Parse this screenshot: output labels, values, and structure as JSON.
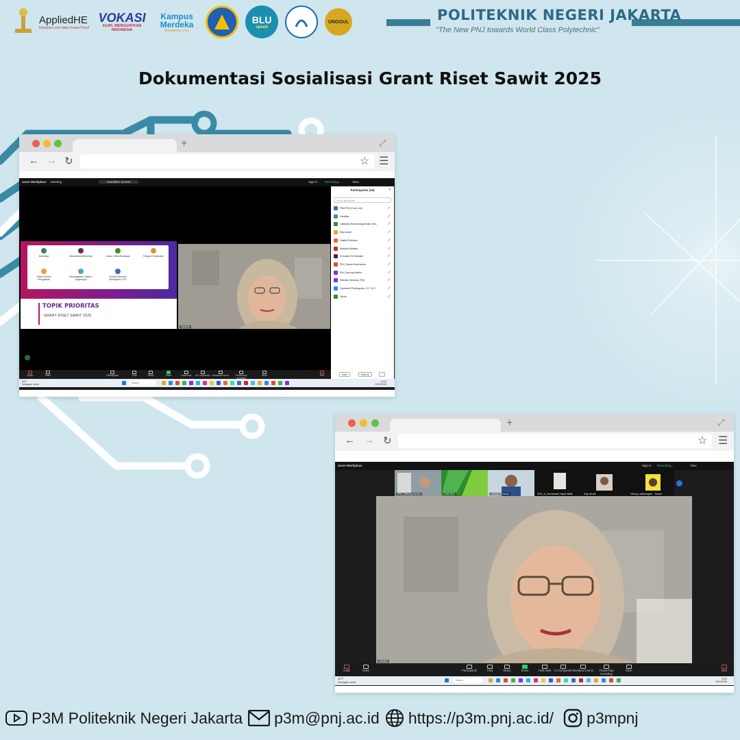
{
  "header": {
    "logos": [
      {
        "name": "appliedhe-logo",
        "text": "AppliedHE",
        "sub": "Entrance cost index Future Proof"
      },
      {
        "name": "vokasi-logo",
        "text": "VOKASI",
        "sub": "KUAT, MENGUATKAN INDONESIA"
      },
      {
        "name": "kampus-merdeka-logo",
        "text": "Kampus Merdeka",
        "sub": "INDONESIA JAYA"
      },
      {
        "name": "tut-wuri-logo",
        "text": ""
      },
      {
        "name": "blu-logo",
        "text": "BLU",
        "sub": "speed"
      },
      {
        "name": "pnj-logo",
        "text": ""
      },
      {
        "name": "unggul-logo",
        "text": "UNGGUL"
      }
    ],
    "institution": "POLITEKNIK NEGERI JAKARTA",
    "tagline": "\"The New PNJ towards World Class Polytechnic\""
  },
  "page_title": "Dokumentasi Sosialisasi Grant Riset Sawit 2025",
  "window1": {
    "zoom_brand": "zoom Workplace",
    "meeting_label": "Meeting",
    "speaker_label": "Handika's screen",
    "sign_in": "Sign in",
    "recording": "Recording...",
    "view": "View",
    "slide": {
      "items": [
        "Bioenergi",
        "Biomaterial (Biokimia)",
        "Lahan / Mitra Budidaya",
        "Pangan/ Kesehatan",
        "Pasca Panen/ Pengolahan",
        "Pemanganan Limbah / Lingkungan",
        "Sosial/ Ekonomi/ Manajemen KTP"
      ],
      "title": "TOPIK PRIORITAS",
      "subtitle": "GRANT RISET SAWIT 2025"
    },
    "camera_name": "Handika",
    "participants": {
      "title": "Participants (10)",
      "search": "Find a participant",
      "list": [
        "P3M PNJ (Host, me)",
        "Handika",
        "Lathriyea Rumondang Bulan Sim...",
        "Edy Ismail",
        "Hasbiy Rahman",
        "Akbiyah Akbiyah",
        "M Kuade Sri Handani",
        "PNJ_Hande Nurrhaman",
        "PNJ_Nurung Hariho",
        "Risballe (Ibbusan_Pki)",
        "Grymestri Pertengozar, S.T., M.T.",
        "Sylvia"
      ],
      "invite": "Invite",
      "mute_all": "Mute all",
      "more": "..."
    },
    "toolbar": [
      "Audio",
      "Video",
      "Participants",
      "Chat",
      "React",
      "Share",
      "Host tools",
      "AI Companion",
      "Breakout rooms",
      "Pause/stop recording",
      "More",
      "End"
    ],
    "taskbar": {
      "weather": "30°F",
      "weather_sub": "Sebagian cerah",
      "search": "Search",
      "time": "13:13",
      "date": "04/02/2025"
    }
  },
  "window2": {
    "zoom_brand": "zoom Workplace",
    "sign_in": "Sign in",
    "recording": "Recording...",
    "view": "View",
    "thumbnails": [
      "PNJ_Nurung Hariho",
      "P3M PNJ",
      "Hasbiy Rahman",
      "2DE_N_Muhamad Hayib Malik",
      "Edy Ismail",
      "Nining Latianingsih - Dosen"
    ],
    "camera_name": "Handika",
    "toolbar": [
      "Audio",
      "Video",
      "Participants",
      "Chat",
      "React",
      "Share",
      "Host tools",
      "AI Companion",
      "Breakout rooms",
      "Pause/stop recording",
      "More",
      "End"
    ],
    "taskbar": {
      "weather": "30°F",
      "weather_sub": "Sebagian cerah",
      "search": "Search",
      "time": "13:30",
      "date": "04/02/2025"
    }
  },
  "footer": {
    "youtube": "P3M Politeknik Negeri Jakarta",
    "email": "p3m@pnj.ac.id",
    "website": "https://p3m.pnj.ac.id/",
    "instagram": "p3mpnj"
  },
  "colors": {
    "background": "#cfe6ee",
    "brand": "#2d6a86",
    "circuit": "#3a7d96"
  }
}
